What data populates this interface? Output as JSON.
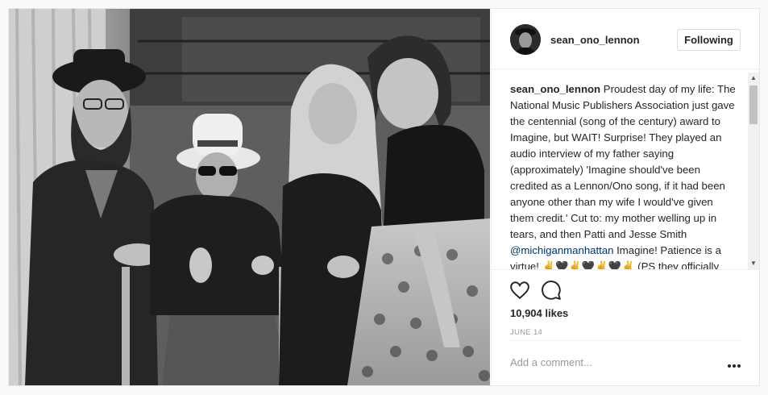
{
  "post": {
    "username": "sean_ono_lennon",
    "follow_label": "Following",
    "caption_username": "sean_ono_lennon",
    "caption_part1": " Proudest day of my life: The National Music Publishers Association just gave the centennial (song of the century) award to Imagine, but WAIT! Surprise! They played an audio interview of my father saying (approximately) 'Imagine should've been credited as a Lennon/Ono song, if it had been anyone other than my wife I would've given them credit.' Cut to: my mother welling up in tears, and then Patti and Jesse Smith ",
    "caption_mention": "@michiganmanhattan",
    "caption_part2": " Imagine! Patience is a virtue! ✌🖤✌🖤✌🖤✌ (PS they officially declared Imagine to be",
    "likes": "10,904 likes",
    "date": "JUNE 14",
    "comment_placeholder": "Add a comment..."
  },
  "icons": {
    "like": "heart-icon",
    "comment": "speech-bubble-icon",
    "more": "more-options-icon",
    "scroll_up": "scroll-up-arrow",
    "scroll_down": "scroll-down-arrow"
  },
  "colors": {
    "mention": "#003569",
    "secondary_text": "#999999",
    "border": "#efefef"
  }
}
